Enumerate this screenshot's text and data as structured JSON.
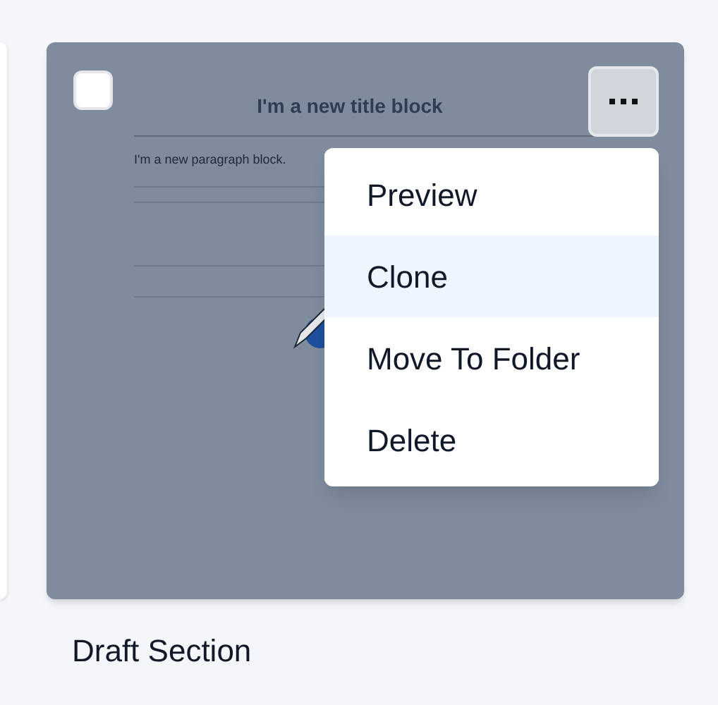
{
  "card": {
    "checked": false,
    "preview": {
      "title": "I'm a new title block",
      "paragraph": "I'm a new paragraph block."
    },
    "menu_open": true,
    "caption": "Draft Section"
  },
  "menu": [
    {
      "label": "Preview",
      "selected": false
    },
    {
      "label": "Clone",
      "selected": true
    },
    {
      "label": "Move To Folder",
      "selected": false
    },
    {
      "label": "Delete",
      "selected": false
    }
  ]
}
